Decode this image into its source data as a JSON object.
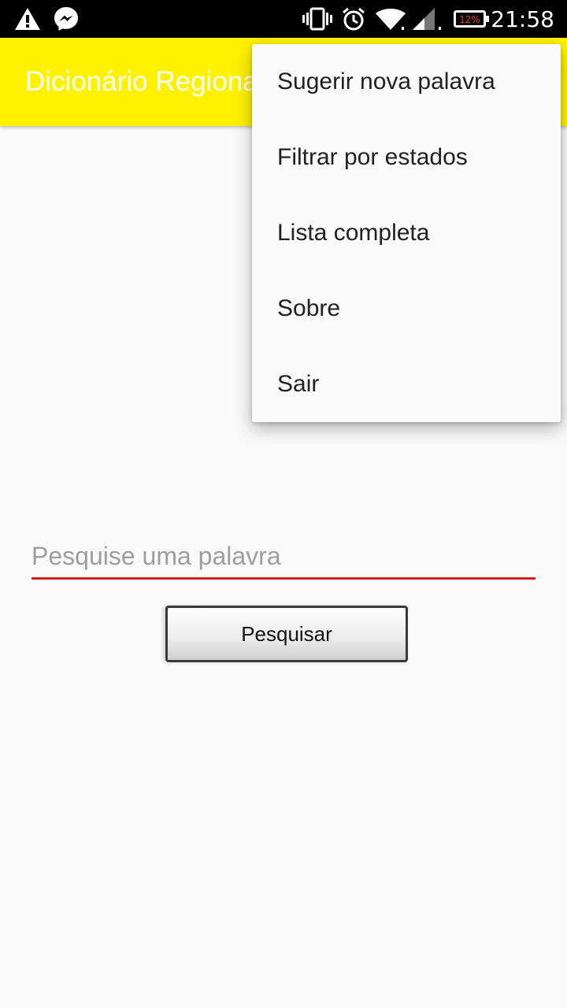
{
  "status_bar": {
    "icons_left": [
      "warning-icon",
      "messenger-icon"
    ],
    "icons_right": [
      "vibrate-icon",
      "alarm-icon",
      "wifi-icon",
      "signal-icon",
      "battery-icon"
    ],
    "battery": "12%",
    "time": "21:58"
  },
  "app_bar": {
    "title": "Dicionário Regional"
  },
  "colors": {
    "app_bar": "#fff200",
    "accent": "#d81b1b",
    "battery_low": "#e53935"
  },
  "menu": {
    "items": [
      {
        "label": "Sugerir nova palavra"
      },
      {
        "label": "Filtrar por estados"
      },
      {
        "label": "Lista completa"
      },
      {
        "label": "Sobre"
      },
      {
        "label": "Sair"
      }
    ]
  },
  "search": {
    "placeholder": "Pesquise uma palavra",
    "button_label": "Pesquisar"
  }
}
